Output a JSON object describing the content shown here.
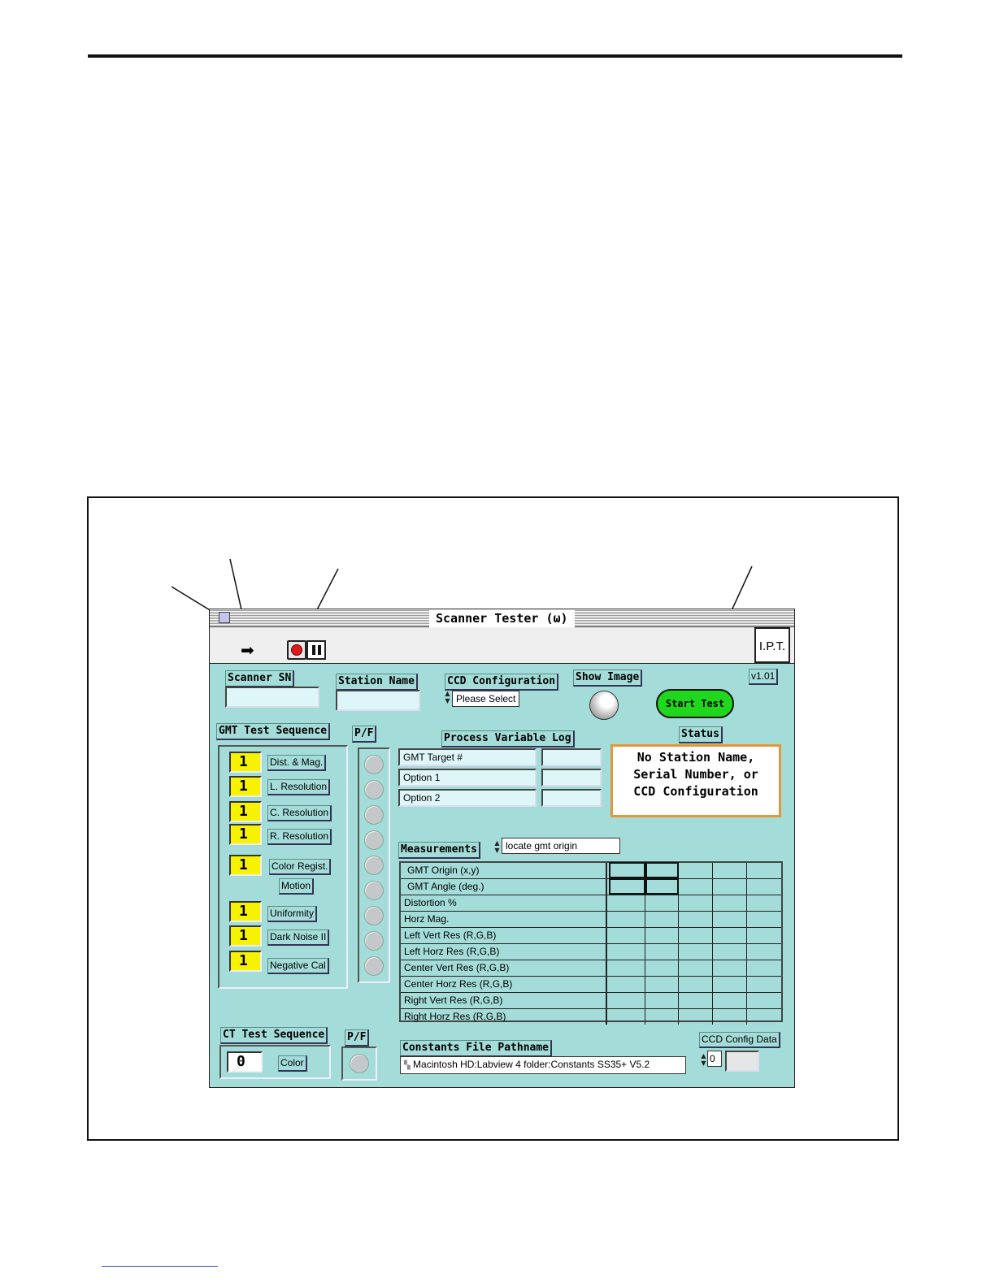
{
  "window": {
    "title": "Scanner Tester (ω)",
    "logo": "I.P.T.",
    "version": "v1.01"
  },
  "toolbar": {
    "run_icon": "run-arrow-icon",
    "stop_icon": "stop-icon",
    "pause_icon": "pause-icon"
  },
  "fields": {
    "scanner_sn_label": "Scanner SN",
    "scanner_sn_value": "",
    "station_name_label": "Station Name",
    "station_name_value": "",
    "ccd_config_label": "CCD Configuration",
    "ccd_config_value": "Please Select",
    "show_image_label": "Show Image",
    "start_test_label": "Start Test"
  },
  "gmt": {
    "label": "GMT Test Sequence",
    "pf_label": "P/F",
    "items": [
      {
        "count": "1",
        "name": "Dist. & Mag."
      },
      {
        "count": "1",
        "name": "L. Resolution"
      },
      {
        "count": "1",
        "name": "C. Resolution"
      },
      {
        "count": "1",
        "name": "R. Resolution"
      },
      {
        "count": "1",
        "name": "Color Regist.",
        "sub": "Motion"
      },
      {
        "count": "1",
        "name": "Uniformity"
      },
      {
        "count": "1",
        "name": "Dark Noise II"
      },
      {
        "count": "1",
        "name": "Negative Cal"
      }
    ]
  },
  "process_log": {
    "label": "Process Variable Log",
    "rows": [
      {
        "name": "GMT Target #",
        "value": ""
      },
      {
        "name": "Option 1",
        "value": ""
      },
      {
        "name": "Option 2",
        "value": ""
      }
    ]
  },
  "status": {
    "label": "Status",
    "message_1": "No Station Name,",
    "message_2": "Serial Number, or",
    "message_3": "CCD Configuration"
  },
  "measurements": {
    "label": "Measurements",
    "selector_value": "locate gmt origin",
    "rows": [
      "GMT Origin (x,y)",
      "GMT Angle (deg.)",
      "Distortion %",
      "Horz Mag.",
      "Left Vert Res (R,G,B)",
      "Left Horz Res (R,G,B)",
      "Center Vert Res (R,G,B)",
      "Center Horz Res (R,G,B)",
      "Right Vert Res (R,G,B)",
      "Right Horz Res (R,G,B)"
    ]
  },
  "ct": {
    "label": "CT Test Sequence",
    "pf_label": "P/F",
    "count": "0",
    "name": "Color"
  },
  "constants": {
    "label": "Constants File Pathname",
    "path": "Macintosh HD:Labview 4 folder:Constants SS35+ V5.2"
  },
  "ccd_config_data": {
    "label": "CCD Config Data",
    "index": "0"
  }
}
